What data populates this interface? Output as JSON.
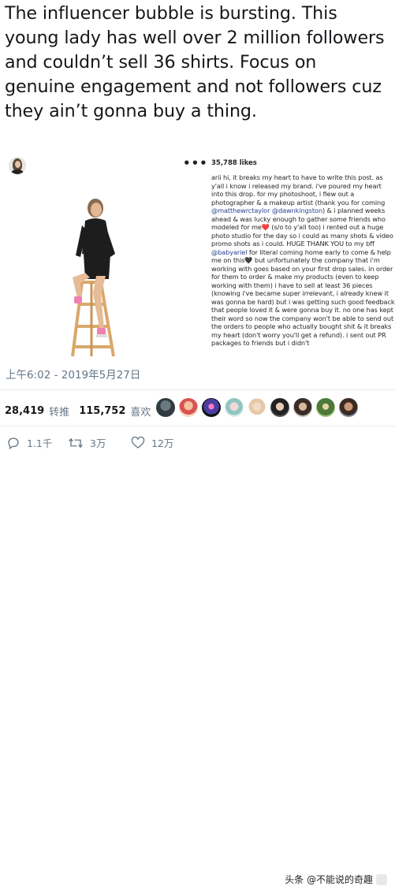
{
  "tweet": {
    "text": "The influencer bubble is bursting. This young lady has well over 2 million followers and couldn’t sell 36 shirts. Focus on genuine engagement and not followers cuz they ain’t gonna buy a thing.",
    "timestamp": "上午6:02 - 2019年5月27日"
  },
  "embedded_post": {
    "more_label": "•••",
    "likes": "35,788 likes",
    "caption": {
      "p1": "arii hi, it breaks my heart to have to write this post. as y'all i know i released my brand. i've poured my heart into this drop. for my photoshoot, i flew out a photographer & a makeup artist (thank you for coming ",
      "m1": "@matthewrctaylor",
      "p2": " ",
      "m2": "@dawnkingston",
      "p3": ") & i planned weeks ahead & was lucky enough to gather some friends who modeled for me",
      "heart_red": "❤️",
      "p4": " (s/o to y'all too) i rented out a huge photo studio for the day so i could as many shots & video promo shots as i could. HUGE THANK YOU to my bff ",
      "m3": "@babyariel",
      "p5": " for literal coming home early to come & help me on this",
      "heart_black": "🖤",
      "p6": " but unfortunately the company that i'm working with goes based on your first drop sales. in order for them to order & make my products (even to keep working with them) i have to sell at least 36 pieces (knowing i've became super irrelevant, i already knew it was gonna be hard) but i was getting such good feedback that people loved it & were gonna buy it. no one has kept their word so now the company won't be able to send out the orders to people who actually bought shit & it breaks my heart (don't worry you'll get a refund). i sent out PR packages to friends but i didn't"
    }
  },
  "stats": {
    "retweets": "28,419",
    "retweets_label": "转推",
    "likes": "115,752",
    "likes_label": "喜欢"
  },
  "actions": {
    "reply_count": "1.1千",
    "retweet_count": "3万",
    "like_count": "12万"
  },
  "watermark": {
    "text": "头条 @不能说的奇趣"
  },
  "colors": {
    "text": "#14171a",
    "secondary": "#657786",
    "mention": "#2a3f8f",
    "divider": "#e6ecf0"
  }
}
